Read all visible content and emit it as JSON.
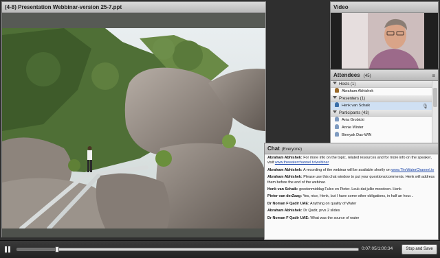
{
  "presentation": {
    "title": "(4-8) Presentation Webbinar-version 25-7.ppt"
  },
  "video": {
    "title": "Video"
  },
  "attendees": {
    "title": "Attendees",
    "count": "(45)",
    "groups": [
      {
        "label": "Hosts (1)",
        "people": [
          {
            "name": "Abraham Abhishek",
            "role": "host",
            "selected": false
          }
        ]
      },
      {
        "label": "Presenters (1)",
        "people": [
          {
            "name": "Henk van Schaik",
            "role": "presenter",
            "selected": true
          }
        ]
      },
      {
        "label": "Participants (43)",
        "people": [
          {
            "name": "Ania Grobicki",
            "role": "participant",
            "selected": false
          },
          {
            "name": "Annie Winter",
            "role": "participant",
            "selected": false
          },
          {
            "name": "Bineyak Das-WIN",
            "role": "participant",
            "selected": false
          }
        ]
      }
    ]
  },
  "chat": {
    "title": "Chat",
    "scope": "(Everyone)",
    "messages": [
      {
        "who": "Abraham Abhishek:",
        "text": "For more info on the topic, related resources and for more info on the speaker, visit ",
        "link": "www.thewaterchannel.tv/webinar"
      },
      {
        "who": "Abraham Abhishek:",
        "text": "A recording of the webinar will be available shortly on ",
        "link": "www.TheWaterChannel.tv"
      },
      {
        "who": "Abraham Abhishek:",
        "text": "Please use this chat window to put your questions/comments. Henk will address them before the end of the webinar.",
        "link": ""
      },
      {
        "who": "Henk van Schaik:",
        "text": "goedenmiddag Fulco en Pieter. Leuk dat jullie meedoen. Henk",
        "link": ""
      },
      {
        "who": "Pieter van derZaag:",
        "text": "Yes, nice, Henk, but I have some other obligations, in half an hour...",
        "link": ""
      },
      {
        "who": "Dr Noman F Qadir UAE:",
        "text": "Anything on quality of Water",
        "link": ""
      },
      {
        "who": "Abraham Abhishek:",
        "text": "Dr Qadir, prvs 2 slides",
        "link": ""
      },
      {
        "who": "Dr Noman F Qadir UAE:",
        "text": "What was the source of water",
        "link": ""
      }
    ]
  },
  "playback": {
    "time": "0:07:05/1:00:34",
    "progress_fraction": 0.117,
    "stop_save_label": "Stop and Save"
  },
  "icons": {
    "pause": "pause-icon",
    "mic": "microphone-icon",
    "menu": "pod-menu-icon"
  }
}
